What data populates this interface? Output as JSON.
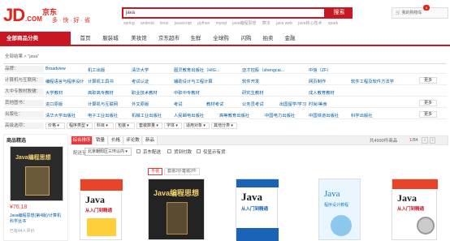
{
  "header": {
    "logo_text": "JD",
    "logo_com": ".COM",
    "logo_cn": "京东",
    "logo_slogan": "多·快·好·省",
    "search_value": "java",
    "search_button": "搜索",
    "hotwords": [
      "spring",
      "android",
      "linux",
      "javascript",
      "python",
      "mysql",
      "java编程思想",
      "算法",
      "java web",
      "java核心技术",
      "spark"
    ],
    "cart_label": "我的购物车",
    "cart_count": "0"
  },
  "nav": {
    "all_categories": "全部商品分类",
    "items": [
      "首页",
      "服装城",
      "美妆馆",
      "京东超市",
      "生鲜",
      "全球购",
      "闪购",
      "拍卖",
      "金融"
    ]
  },
  "breadcrumb": "全部结果 > \"java\"",
  "filters": [
    {
      "label": "品牌：",
      "values": [
        "Broadview",
        "机工出版",
        "清华大学",
        "图灵教育出版社（HIG...",
        "亚才控股（shengcai...",
        "中信（ZF）"
      ],
      "more": ""
    },
    {
      "label": "计算机与互联网：",
      "values": [
        "编程语言与程序设计",
        "计算机工具书",
        "考试认证",
        "辅助设计与工程计算",
        "软件开发",
        "网页制作",
        "软件工程及软件方法学"
      ],
      "more": "更多"
    },
    {
      "label": "大中专教材教辅：",
      "values": [
        "大学教材",
        "高职高专教材",
        "职业技术教材",
        "中职中专教材",
        "研究生教材",
        "成人教育教材"
      ],
      "more": ""
    },
    {
      "label": "其他图书：",
      "values": [
        "进口原版",
        "计算机与互联网",
        "外文原版",
        "考试",
        "教材考试",
        "公务员考试",
        "出国留学/学习",
        "时尚/美食"
      ],
      "more": "更多"
    },
    {
      "label": "出版社：",
      "values": [
        "清华大学出版社",
        "电子工业出版社",
        "机械工业出版社",
        "人民邮电出版社",
        "高等教育出版社",
        "中国电力出版社",
        "中国铁道出版社",
        "科学出版社"
      ],
      "more": "更多"
    },
    {
      "label": "高级选项：",
      "dropdowns": [
        "价格",
        "程序类型",
        "科目",
        "包装",
        "套装数量",
        "字体",
        "适用对象",
        "其他分类"
      ],
      "more": ""
    }
  ],
  "sidebar": {
    "title": "商品精选",
    "price": "¥76.18",
    "name": "Java编程思想(第4版)/计算机科学丛书",
    "comments": "已有44人评价"
  },
  "sortbar": {
    "buttons": [
      "综合排序",
      "销量",
      "价格",
      "评论数",
      "新品"
    ],
    "result_count": "共4990件商品",
    "page_current": "1",
    "page_total": "/84"
  },
  "delivery": {
    "label": "配送至",
    "location": "北京朝阳区三环以内",
    "options": [
      "京东配送",
      "货到付款",
      "仅显示有货"
    ]
  },
  "products": [
    {
      "tabs": [
        "平装",
        "套装2件"
      ],
      "cover_title": "Java",
      "cover_sub": "从入门到精通"
    },
    {
      "tabs": [
        "套装2件",
        "套装2件"
      ],
      "cover_title": "Java编程思想",
      "cover_sub": ""
    },
    {
      "tabs": [],
      "cover_title": "Java",
      "cover_sub": "从入门到精通"
    },
    {
      "tabs": [],
      "cover_title": "Java",
      "cover_sub": "程序设计教程"
    },
    {
      "tabs": [],
      "cover_title": "Java",
      "cover_sub": "从入门到精通"
    }
  ],
  "colors": {
    "brand_red": "#c81623",
    "link_blue": "#005aa0",
    "price_red": "#e4393c"
  }
}
